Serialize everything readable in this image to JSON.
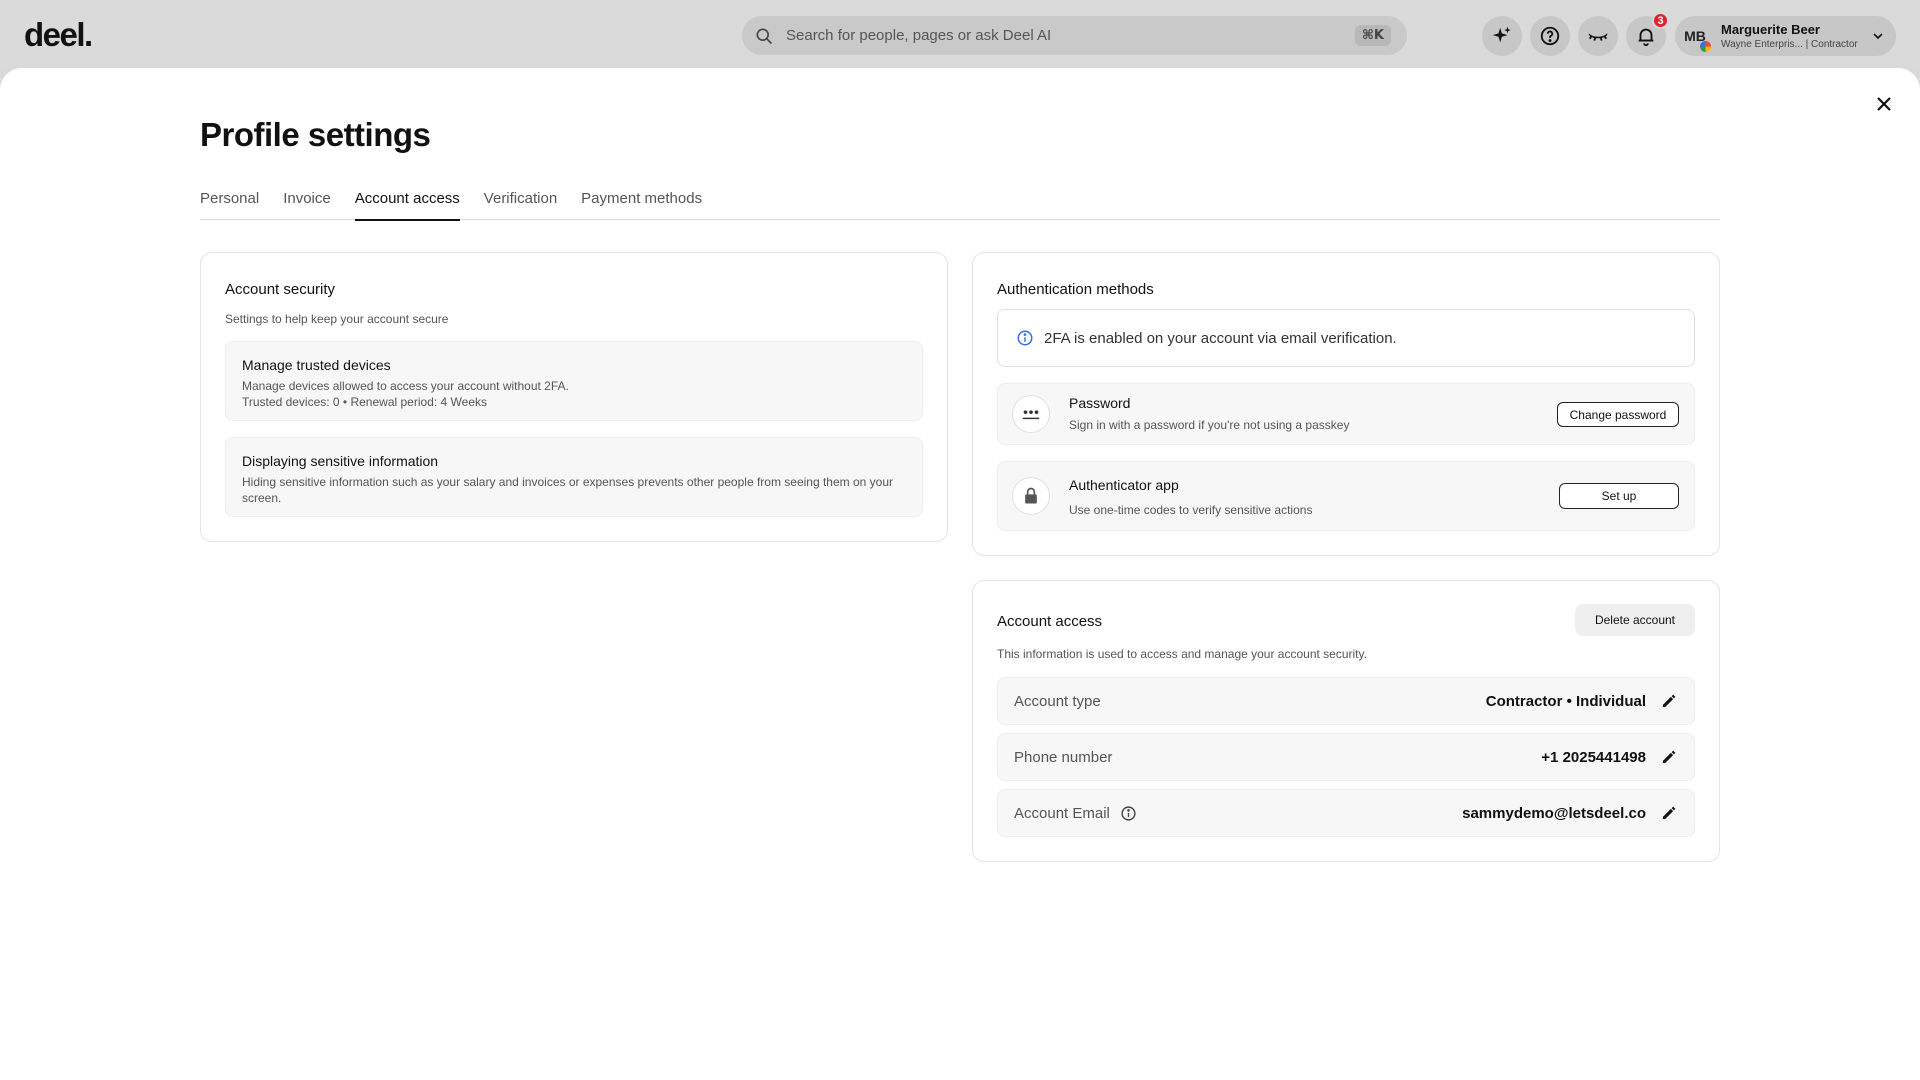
{
  "topbar": {
    "logo": "deel.",
    "search_placeholder": "Search for people, pages or ask Deel AI",
    "search_shortcut": "⌘K",
    "notification_count": "3",
    "user": {
      "initials": "MB",
      "name": "Marguerite Beer",
      "subtitle": "Wayne Enterpris... | Contractor"
    }
  },
  "page": {
    "title": "Profile settings",
    "tabs": [
      {
        "label": "Personal",
        "active": false
      },
      {
        "label": "Invoice",
        "active": false
      },
      {
        "label": "Account access",
        "active": true
      },
      {
        "label": "Verification",
        "active": false
      },
      {
        "label": "Payment methods",
        "active": false
      }
    ]
  },
  "account_security": {
    "title": "Account security",
    "subtitle": "Settings to help keep your account secure",
    "trusted_devices": {
      "title": "Manage trusted devices",
      "description": "Manage devices allowed to access your account without 2FA.",
      "meta": "Trusted devices: 0 • Renewal period: 4 Weeks"
    },
    "sensitive_info": {
      "title": "Displaying sensitive information",
      "description": "Hiding sensitive information such as your salary and invoices or expenses prevents other people from seeing them on your screen."
    }
  },
  "auth_methods": {
    "title": "Authentication methods",
    "info": "2FA is enabled on your account via email verification.",
    "password": {
      "title": "Password",
      "description": "Sign in with a password if you're not using a passkey",
      "button": "Change password"
    },
    "authenticator": {
      "title": "Authenticator app",
      "description": "Use one-time codes to verify sensitive actions",
      "button": "Set up"
    }
  },
  "account_access": {
    "title": "Account access",
    "subtitle": "This information is used to access and manage your account security.",
    "delete_button": "Delete account",
    "rows": [
      {
        "label": "Account type",
        "value": "Contractor • Individual"
      },
      {
        "label": "Phone number",
        "value": "+1 2025441498"
      },
      {
        "label": "Account Email",
        "value": "sammydemo@letsdeel.co"
      }
    ]
  },
  "colors": {
    "accent_info": "#3b6fd8",
    "badge": "#e0222f"
  }
}
